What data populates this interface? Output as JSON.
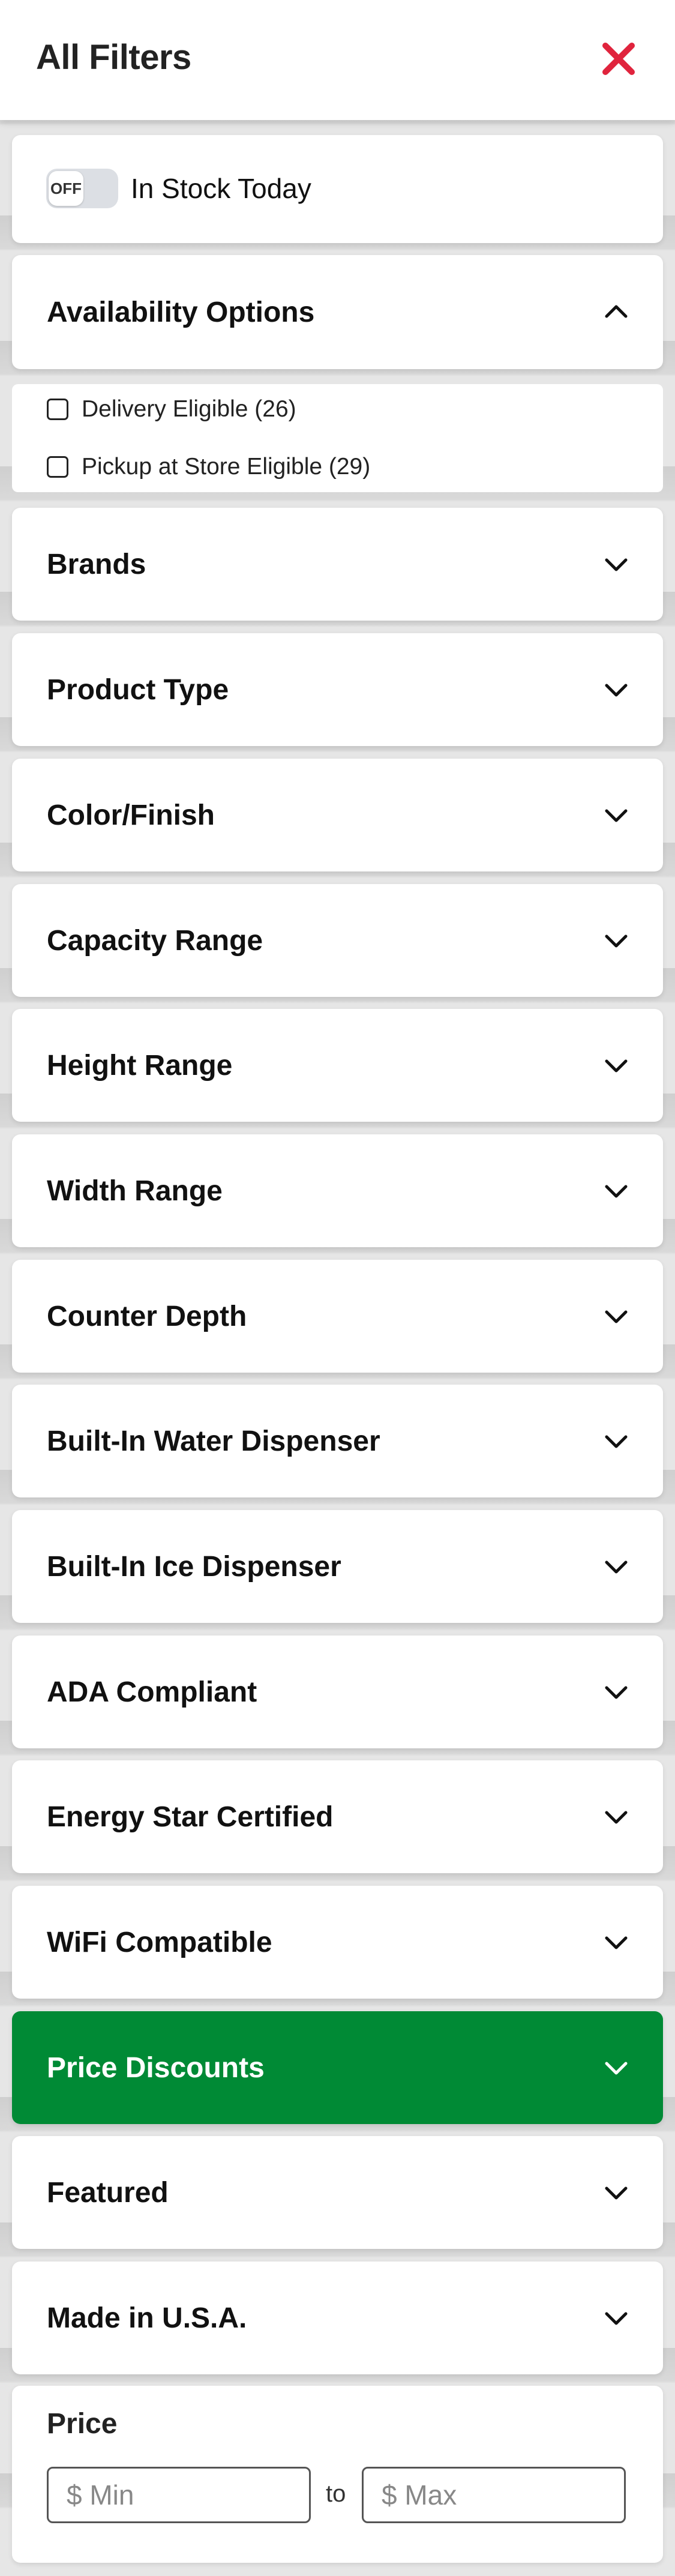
{
  "header": {
    "title": "All Filters"
  },
  "in_stock": {
    "toggle_state": "OFF",
    "label": "In Stock Today"
  },
  "availability": {
    "title": "Availability Options",
    "options": [
      {
        "label": "Delivery Eligible (26)",
        "checked": false
      },
      {
        "label": "Pickup at Store Eligible (29)",
        "checked": false
      }
    ]
  },
  "filters": [
    {
      "label": "Brands"
    },
    {
      "label": "Product Type"
    },
    {
      "label": "Color/Finish"
    },
    {
      "label": "Capacity Range"
    },
    {
      "label": "Height Range"
    },
    {
      "label": "Width Range"
    },
    {
      "label": "Counter Depth"
    },
    {
      "label": "Built-In Water Dispenser"
    },
    {
      "label": "Built-In Ice Dispenser"
    },
    {
      "label": "ADA Compliant"
    },
    {
      "label": "Energy Star Certified"
    },
    {
      "label": "WiFi Compatible"
    },
    {
      "label": "Price Discounts",
      "highlighted": true
    },
    {
      "label": "Featured"
    },
    {
      "label": "Made in U.S.A."
    }
  ],
  "price": {
    "title": "Price",
    "min_placeholder": "$ Min",
    "max_placeholder": "$ Max",
    "to_label": "to"
  },
  "colors": {
    "close_icon": "#e0243d",
    "highlight": "#008a35",
    "toggle_off_bg": "#dcdfe4"
  },
  "icons": {
    "close": "close-icon",
    "expanded": "chevron-up-icon",
    "collapsed": "chevron-down-icon"
  }
}
